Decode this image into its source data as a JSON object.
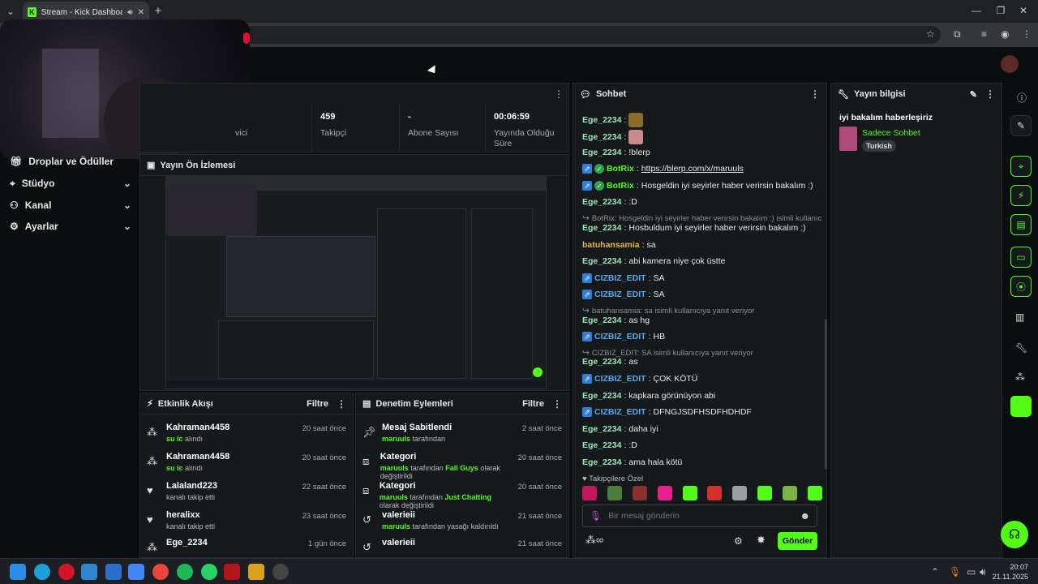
{
  "browser": {
    "tab_title": "Stream - Kick Dashboard",
    "new_tab": "+",
    "win_min": "—",
    "win_max": "❐",
    "win_close": "✕"
  },
  "sidebar": {
    "items": [
      {
        "label": "Droplar ve Ödüller",
        "icon": "gift-icon"
      },
      {
        "label": "Stüdyo",
        "icon": "studio-icon"
      },
      {
        "label": "Kanal",
        "icon": "channel-icon"
      },
      {
        "label": "Ayarlar",
        "icon": "gear-icon"
      }
    ]
  },
  "stats": [
    {
      "value": "",
      "label": "vici"
    },
    {
      "value": "459",
      "label": "Takipçi"
    },
    {
      "value": "-",
      "label": "Abone Sayısı"
    },
    {
      "value": "00:06:59",
      "label": "Yayında Olduğu Süre"
    }
  ],
  "preview": {
    "title": "Yayın Ön İzlemesi"
  },
  "activity": {
    "title": "Etkinlik Akışı",
    "filter": "Filtre",
    "items": [
      {
        "user": "Kahraman4458",
        "highlight": "su ic",
        "rest": " alındı",
        "time": "20 saat önce",
        "icon": "kick-icon"
      },
      {
        "user": "Kahraman4458",
        "highlight": "su ic",
        "rest": " alındı",
        "time": "20 saat önce",
        "icon": "kick-icon"
      },
      {
        "user": "Lalaland223",
        "highlight": "",
        "rest": "kanalı takip etti",
        "time": "22 saat önce",
        "icon": "heart-icon"
      },
      {
        "user": "heralixx",
        "highlight": "",
        "rest": "kanalı takip etti",
        "time": "23 saat önce",
        "icon": "heart-icon"
      },
      {
        "user": "Ege_2234",
        "highlight": "",
        "rest": "",
        "time": "1 gün önce",
        "icon": "kick-icon"
      }
    ]
  },
  "moderation": {
    "title": "Denetim Eylemleri",
    "filter": "Filtre",
    "items": [
      {
        "title": "Mesaj Sabitlendi",
        "user": "maruuls",
        "mid": " tarafından",
        "game": "",
        "end": "",
        "time": "2 saat önce",
        "icon": "pin-icon"
      },
      {
        "title": "Kategori",
        "user": "maruuls",
        "mid": " tarafından ",
        "game": "Fall Guys",
        "end": " olarak değiştirildi",
        "time": "20 saat önce",
        "icon": "category-icon"
      },
      {
        "title": "Kategori",
        "user": "maruuls",
        "mid": " tarafından ",
        "game": "Just Chatting",
        "end": " olarak değiştirildi",
        "time": "20 saat önce",
        "icon": "category-icon"
      },
      {
        "title": "valerieii",
        "user": "maruuls",
        "mid": " tarafından yasağı kaldırıldı",
        "game": "",
        "end": "",
        "time": "21 saat önce",
        "icon": "undo-icon"
      },
      {
        "title": "valerieii",
        "user": "",
        "mid": "",
        "game": "",
        "end": "",
        "time": "21 saat önce",
        "icon": "undo-icon"
      }
    ]
  },
  "chat": {
    "title": "Sohbet",
    "messages": [
      {
        "user": "Ege_2234",
        "cls": "u-g",
        "text": "",
        "emote": true
      },
      {
        "user": "Ege_2234",
        "cls": "u-g",
        "text": "",
        "emote": true
      },
      {
        "user": "Ege_2234",
        "cls": "u-g",
        "text": "!blerp"
      },
      {
        "user": "BotRix",
        "cls": "u-bot",
        "text": "https://blerp.com/x/maruuls",
        "bot": true,
        "link": true
      },
      {
        "user": "BotRix",
        "cls": "u-bot",
        "text": "Hosgeldin iyi seyirler haber verirsin bakalım :)",
        "bot": true
      },
      {
        "user": "Ege_2234",
        "cls": "u-g",
        "text": ":D"
      },
      {
        "reply": "BotRix: Hosgeldin iyi seyirler haber verirsin bakalım :) isimli kullanıcıya..."
      },
      {
        "user": "Ege_2234",
        "cls": "u-g",
        "text": "Hosbuldum iyi seyirler haber verirsin bakalım :)"
      },
      {
        "user": "batuhansamia",
        "cls": "u-o",
        "text": "sa"
      },
      {
        "user": "Ege_2234",
        "cls": "u-g",
        "text": "abi kamera niye çok üstte"
      },
      {
        "user": "CIZBIZ_EDIT",
        "cls": "u-b",
        "text": "SA",
        "badge": true
      },
      {
        "user": "CIZBIZ_EDIT",
        "cls": "u-b",
        "text": "SA",
        "badge": true
      },
      {
        "reply": "batuhansamia: sa isimli kullanıcıya yanıt veriyor"
      },
      {
        "user": "Ege_2234",
        "cls": "u-g",
        "text": "as hg"
      },
      {
        "user": "CIZBIZ_EDIT",
        "cls": "u-b",
        "text": "HB",
        "badge": true
      },
      {
        "reply": "CIZBIZ_EDIT: SA isimli kullanıcıya yanıt veriyor"
      },
      {
        "user": "Ege_2234",
        "cls": "u-g",
        "text": "as"
      },
      {
        "user": "CIZBIZ_EDIT",
        "cls": "u-b",
        "text": "ÇOK KÖTÜ",
        "badge": true
      },
      {
        "user": "Ege_2234",
        "cls": "u-g",
        "text": "kapkara görünüyon abi"
      },
      {
        "user": "CIZBIZ_EDIT",
        "cls": "u-b",
        "text": "DFNGJSDFHSDFHDHDF",
        "badge": true
      },
      {
        "user": "Ege_2234",
        "cls": "u-g",
        "text": "daha iyi"
      },
      {
        "user": "Ege_2234",
        "cls": "u-g",
        "text": ":D"
      },
      {
        "user": "Ege_2234",
        "cls": "u-g",
        "text": "ama hala kötü"
      }
    ],
    "followers_only": "Takipçilere Özel",
    "placeholder": "Bir mesaj gönderin",
    "send": "Gönder",
    "emote_colors": [
      "#c2185b",
      "#4a7c3a",
      "#8b2e2e",
      "#e91e8c",
      "#53fc18",
      "#d32f2f",
      "#9e9e9e",
      "#53fc18",
      "#7cb342",
      "#53fc18"
    ]
  },
  "info": {
    "title": "Yayın bilgisi",
    "stream_title": "iyi bakalım haberleşiriz",
    "category": "Sadece Sohbet",
    "language": "Turkish"
  },
  "taskbar": {
    "time": "20:07",
    "date": "21.11.2025"
  }
}
